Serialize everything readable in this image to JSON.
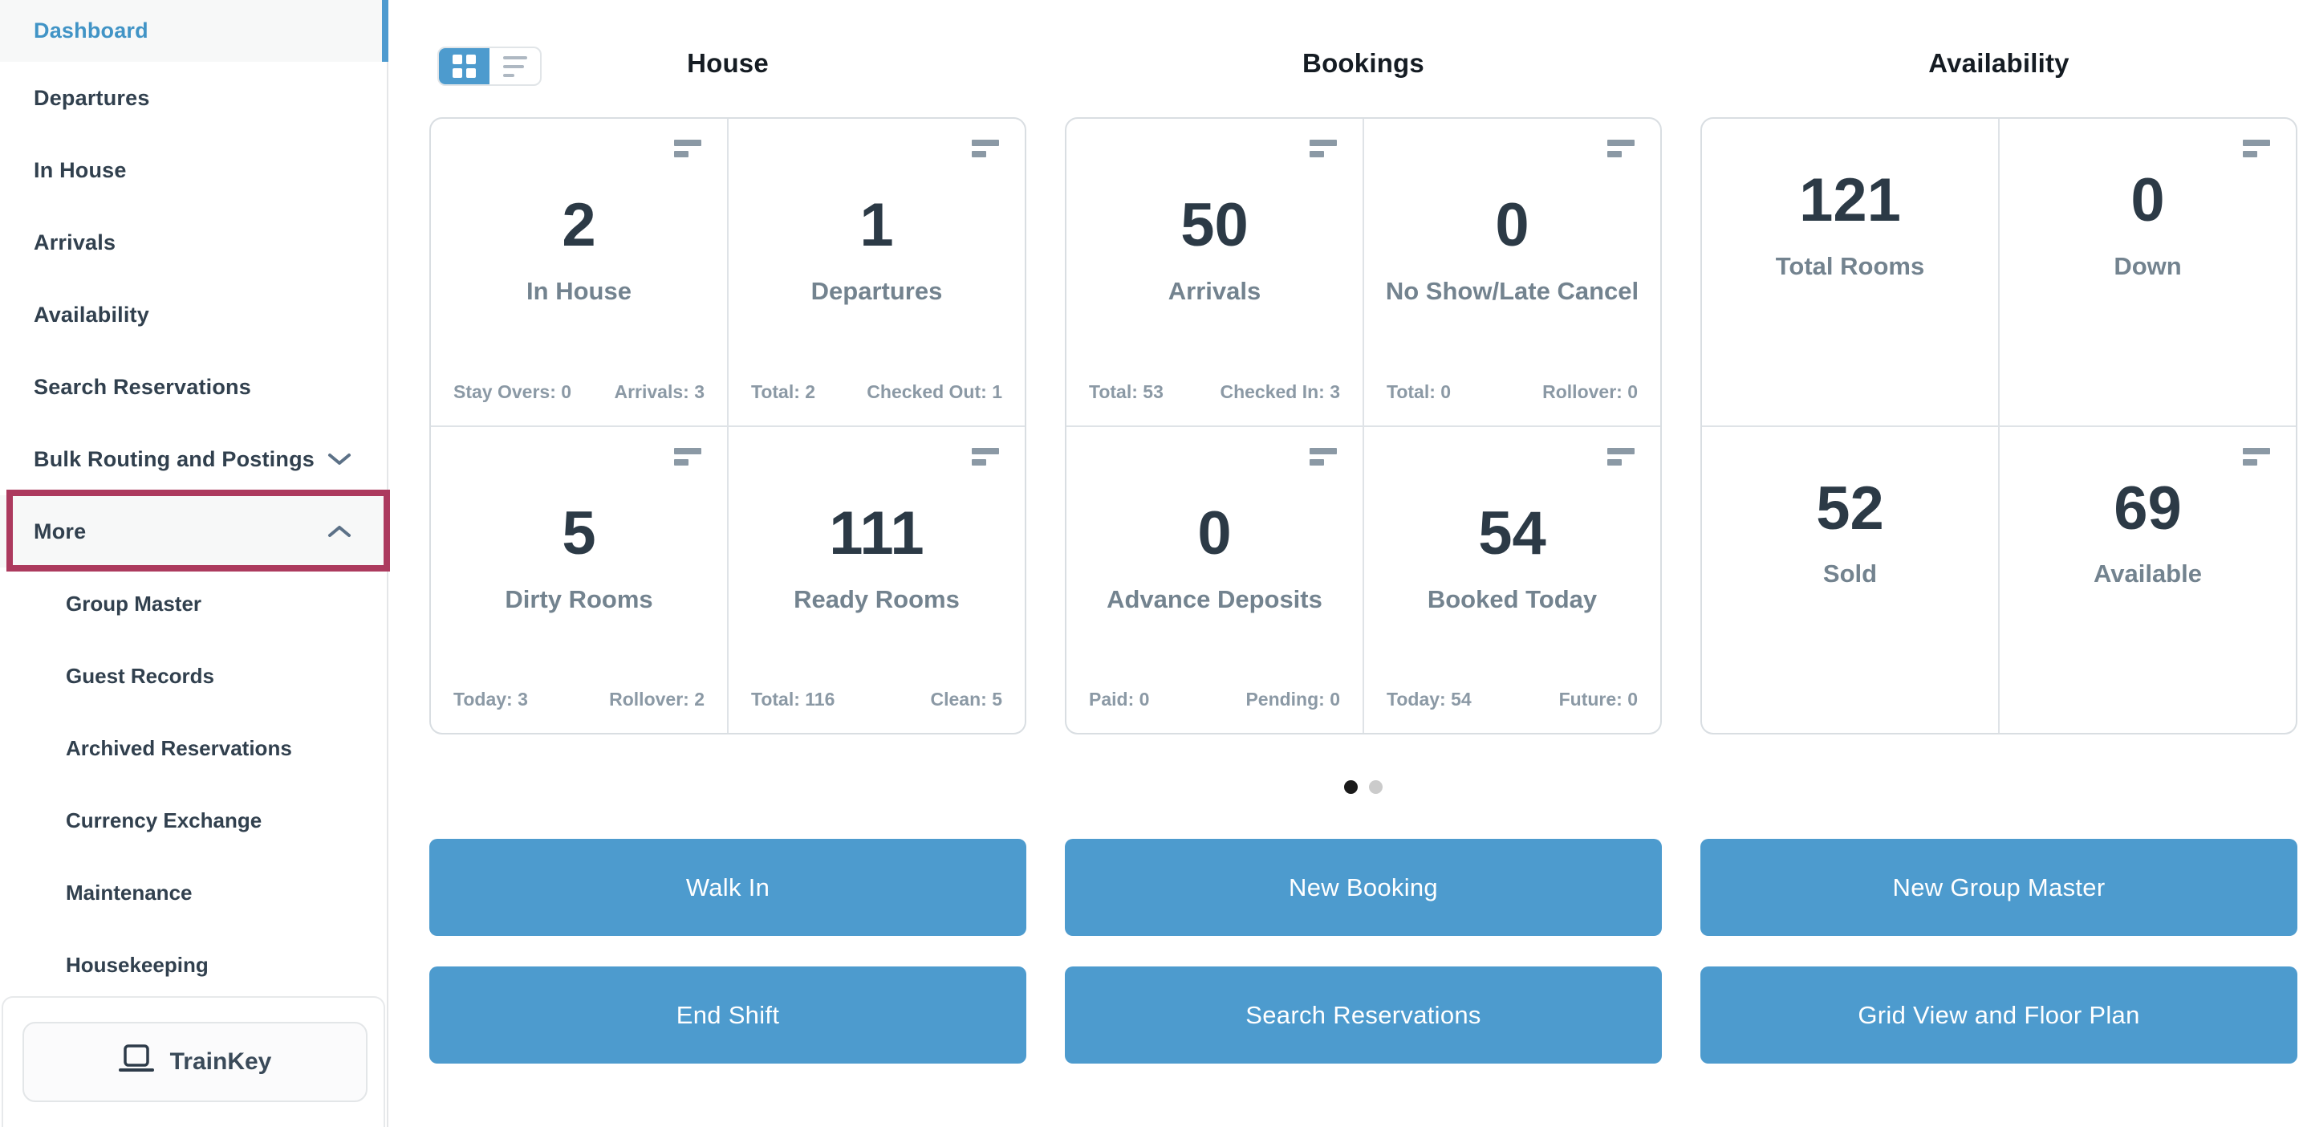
{
  "sidebar": {
    "items": [
      {
        "label": "Dashboard"
      },
      {
        "label": "Departures"
      },
      {
        "label": "In House"
      },
      {
        "label": "Arrivals"
      },
      {
        "label": "Availability"
      },
      {
        "label": "Search Reservations"
      },
      {
        "label": "Bulk Routing and Postings"
      },
      {
        "label": "More"
      }
    ],
    "more_subitems": [
      {
        "label": "Group Master"
      },
      {
        "label": "Guest Records"
      },
      {
        "label": "Archived Reservations"
      },
      {
        "label": "Currency Exchange"
      },
      {
        "label": "Maintenance"
      },
      {
        "label": "Housekeeping"
      }
    ],
    "trainkey": {
      "label": "TrainKey"
    }
  },
  "annotation": {
    "highlighted_item": "More",
    "color": "#ac3a5e"
  },
  "columns": [
    {
      "title": "House",
      "cards": [
        {
          "value": "2",
          "label": "In House",
          "stat_left": "Stay Overs: 0",
          "stat_right": "Arrivals: 3"
        },
        {
          "value": "1",
          "label": "Departures",
          "stat_left": "Total: 2",
          "stat_right": "Checked Out: 1"
        },
        {
          "value": "5",
          "label": "Dirty Rooms",
          "stat_left": "Today: 3",
          "stat_right": "Rollover: 2"
        },
        {
          "value": "111",
          "label": "Ready Rooms",
          "stat_left": "Total: 116",
          "stat_right": "Clean: 5"
        }
      ],
      "buttons": [
        "Walk In",
        "End Shift"
      ]
    },
    {
      "title": "Bookings",
      "cards": [
        {
          "value": "50",
          "label": "Arrivals",
          "stat_left": "Total: 53",
          "stat_right": "Checked In: 3"
        },
        {
          "value": "0",
          "label": "No Show/Late Cancel",
          "stat_left": "Total: 0",
          "stat_right": "Rollover: 0"
        },
        {
          "value": "0",
          "label": "Advance Deposits",
          "stat_left": "Paid: 0",
          "stat_right": "Pending: 0"
        },
        {
          "value": "54",
          "label": "Booked Today",
          "stat_left": "Today: 54",
          "stat_right": "Future: 0"
        }
      ],
      "buttons": [
        "New Booking",
        "Search Reservations"
      ]
    },
    {
      "title": "Availability",
      "cards": [
        {
          "value": "121",
          "label": "Total Rooms"
        },
        {
          "value": "0",
          "label": "Down"
        },
        {
          "value": "52",
          "label": "Sold"
        },
        {
          "value": "69",
          "label": "Available"
        }
      ],
      "buttons": [
        "New Group Master",
        "Grid View and Floor Plan"
      ]
    }
  ],
  "pagination": {
    "total_pages": 2,
    "active_page": 1
  },
  "colors": {
    "accent_blue": "#4d9bce",
    "active_item_blue": "#4194c6",
    "annotation_red": "#ac3a5e",
    "card_value": "#2c3a46",
    "card_label": "#73838f",
    "stats_gray": "#8b99a5"
  }
}
